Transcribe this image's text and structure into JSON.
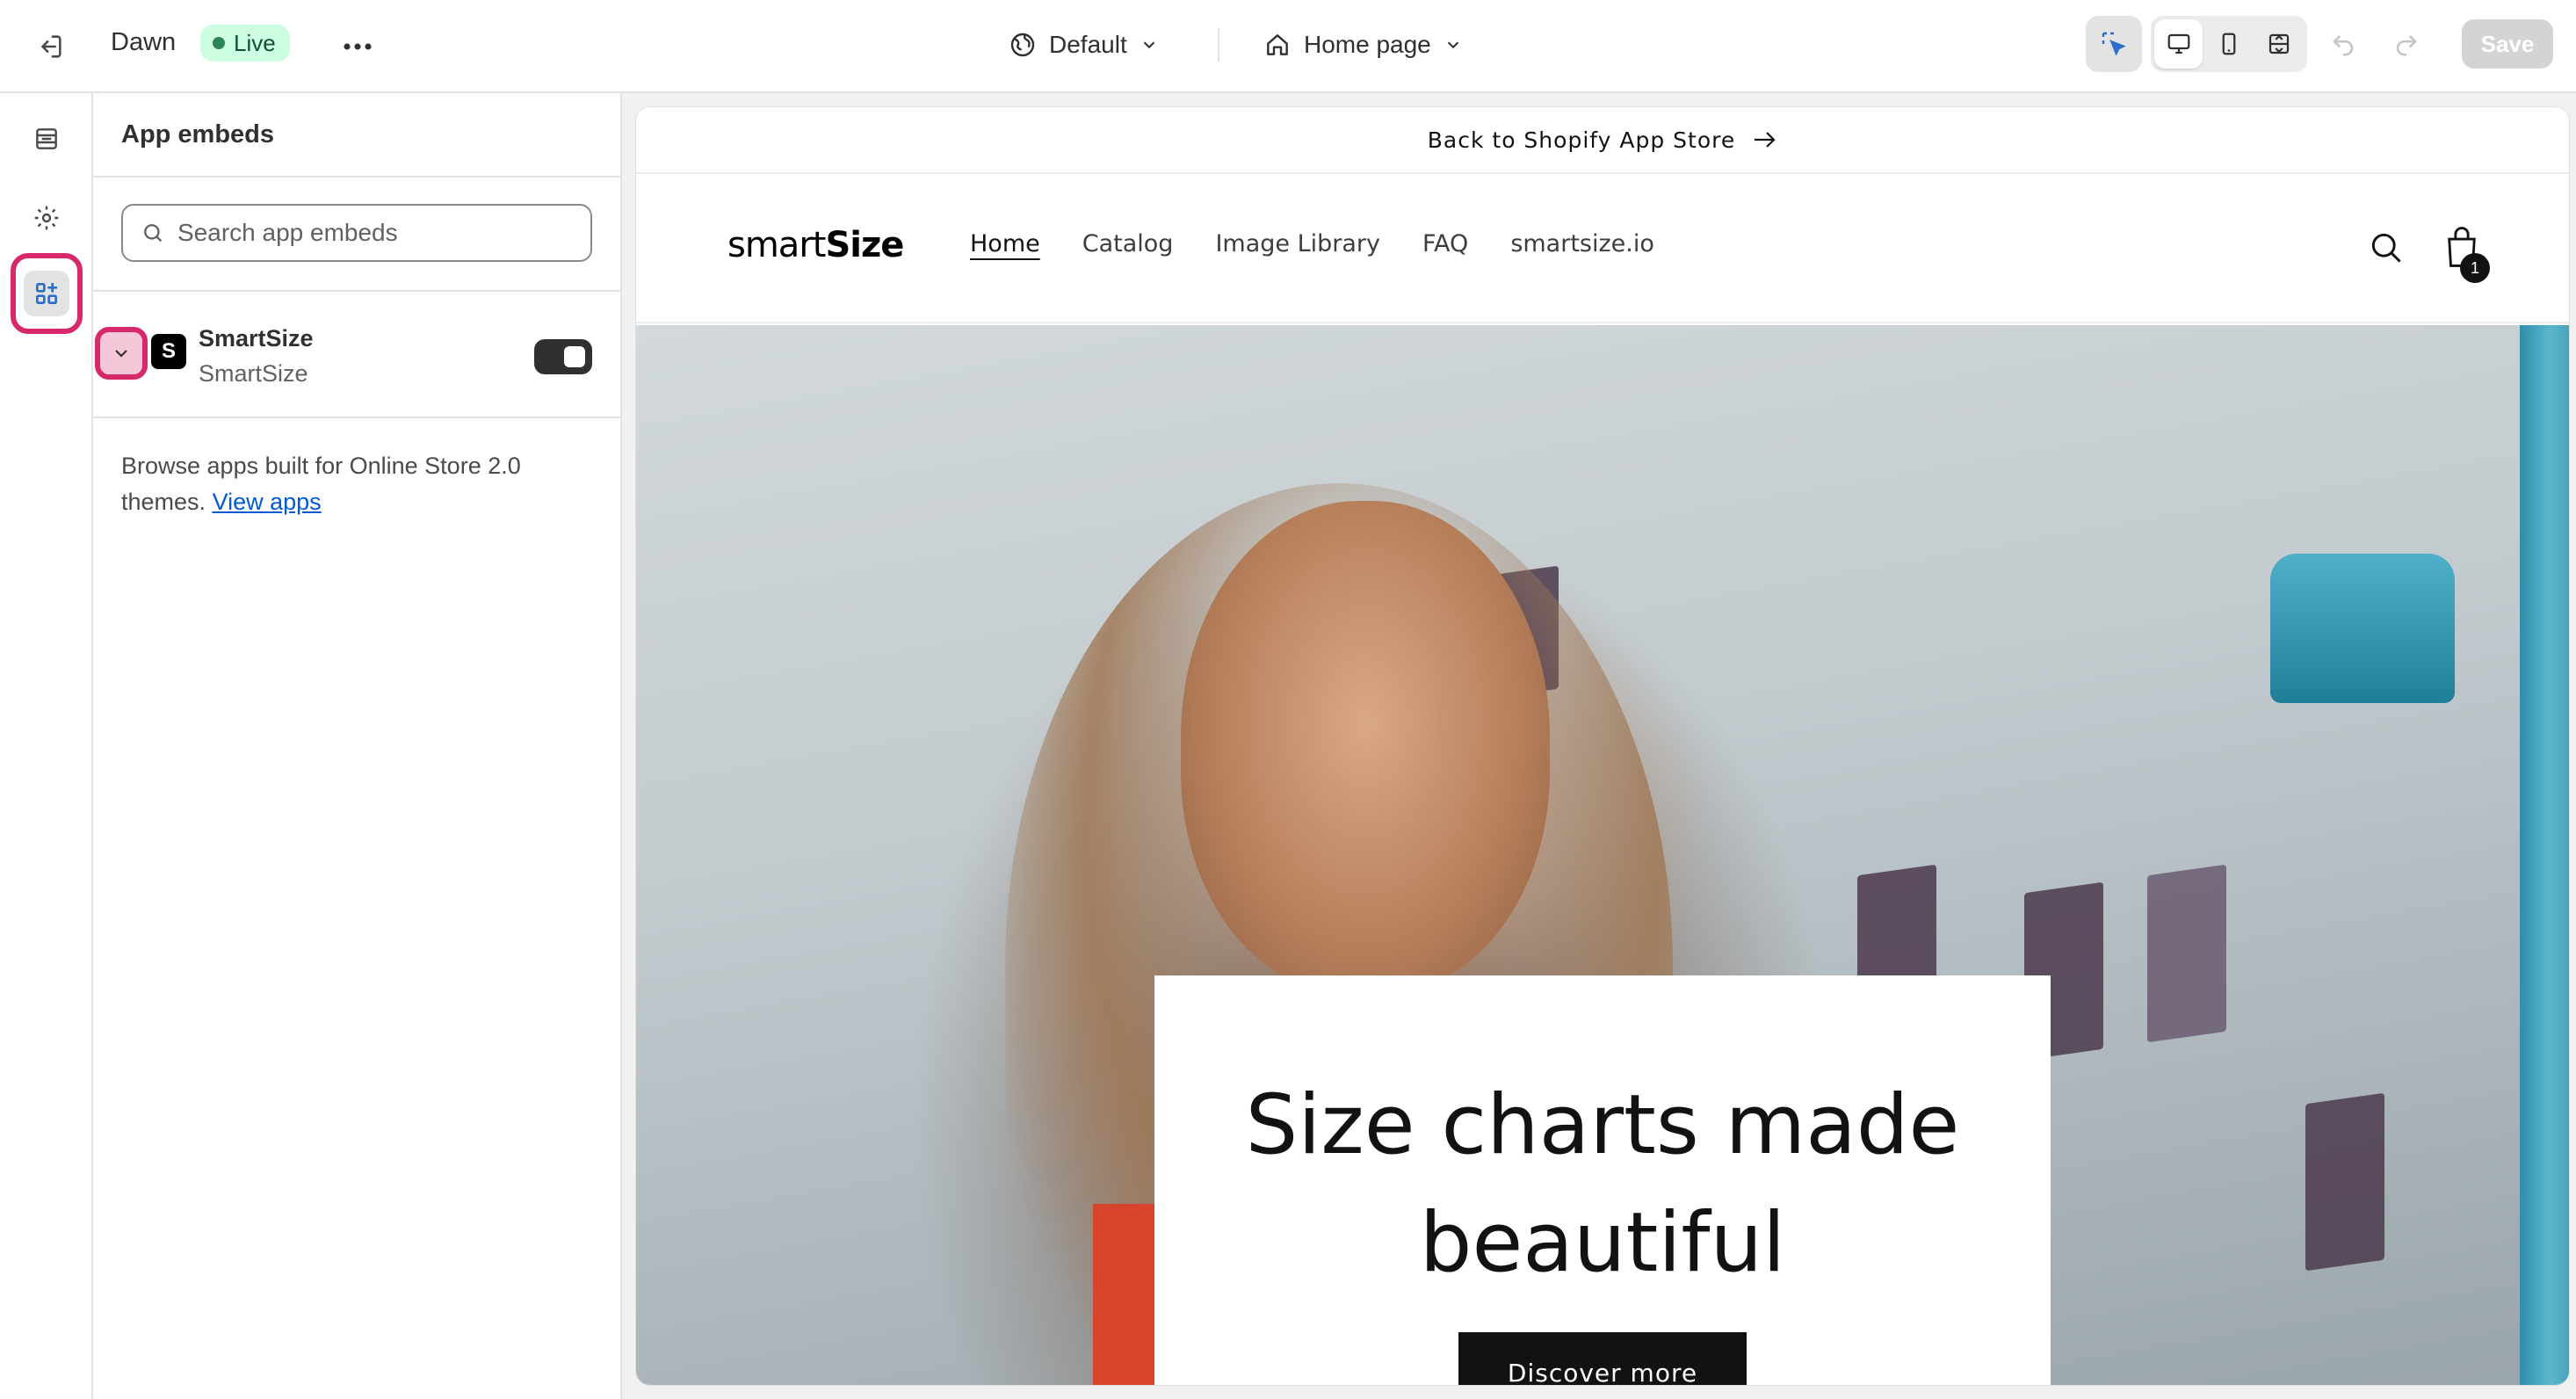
{
  "topbar": {
    "exit_icon": "exit-icon",
    "theme_name": "Dawn",
    "status": "Live",
    "more_icon": "more-horizontal-icon",
    "market_label": "Default",
    "page_label": "Home page",
    "save_label": "Save"
  },
  "rail": {
    "items": [
      {
        "name": "sections",
        "icon": "sections-icon"
      },
      {
        "name": "theme-settings",
        "icon": "gear-icon"
      },
      {
        "name": "app-embeds",
        "icon": "app-embed-icon",
        "active": true
      }
    ]
  },
  "panel": {
    "title": "App embeds",
    "search_placeholder": "Search app embeds",
    "app": {
      "name": "SmartSize",
      "subtitle": "SmartSize",
      "logo_letter": "S",
      "enabled": true
    },
    "browse_text": "Browse apps built for Online Store 2.0 themes.",
    "browse_link": "View apps"
  },
  "preview": {
    "announcement": "Back to Shopify App Store",
    "logo_prefix": "smart",
    "logo_suffix": "Size",
    "nav": [
      "Home",
      "Catalog",
      "Image Library",
      "FAQ",
      "smartsize.io"
    ],
    "cart_count": "1",
    "hero_title": "Size charts made beautiful",
    "hero_button": "Discover more"
  },
  "colors": {
    "live_badge_bg": "#cdfee1",
    "highlight_ring": "#d6286b",
    "link": "#005bd3",
    "save_disabled": "#d4d4d4"
  }
}
